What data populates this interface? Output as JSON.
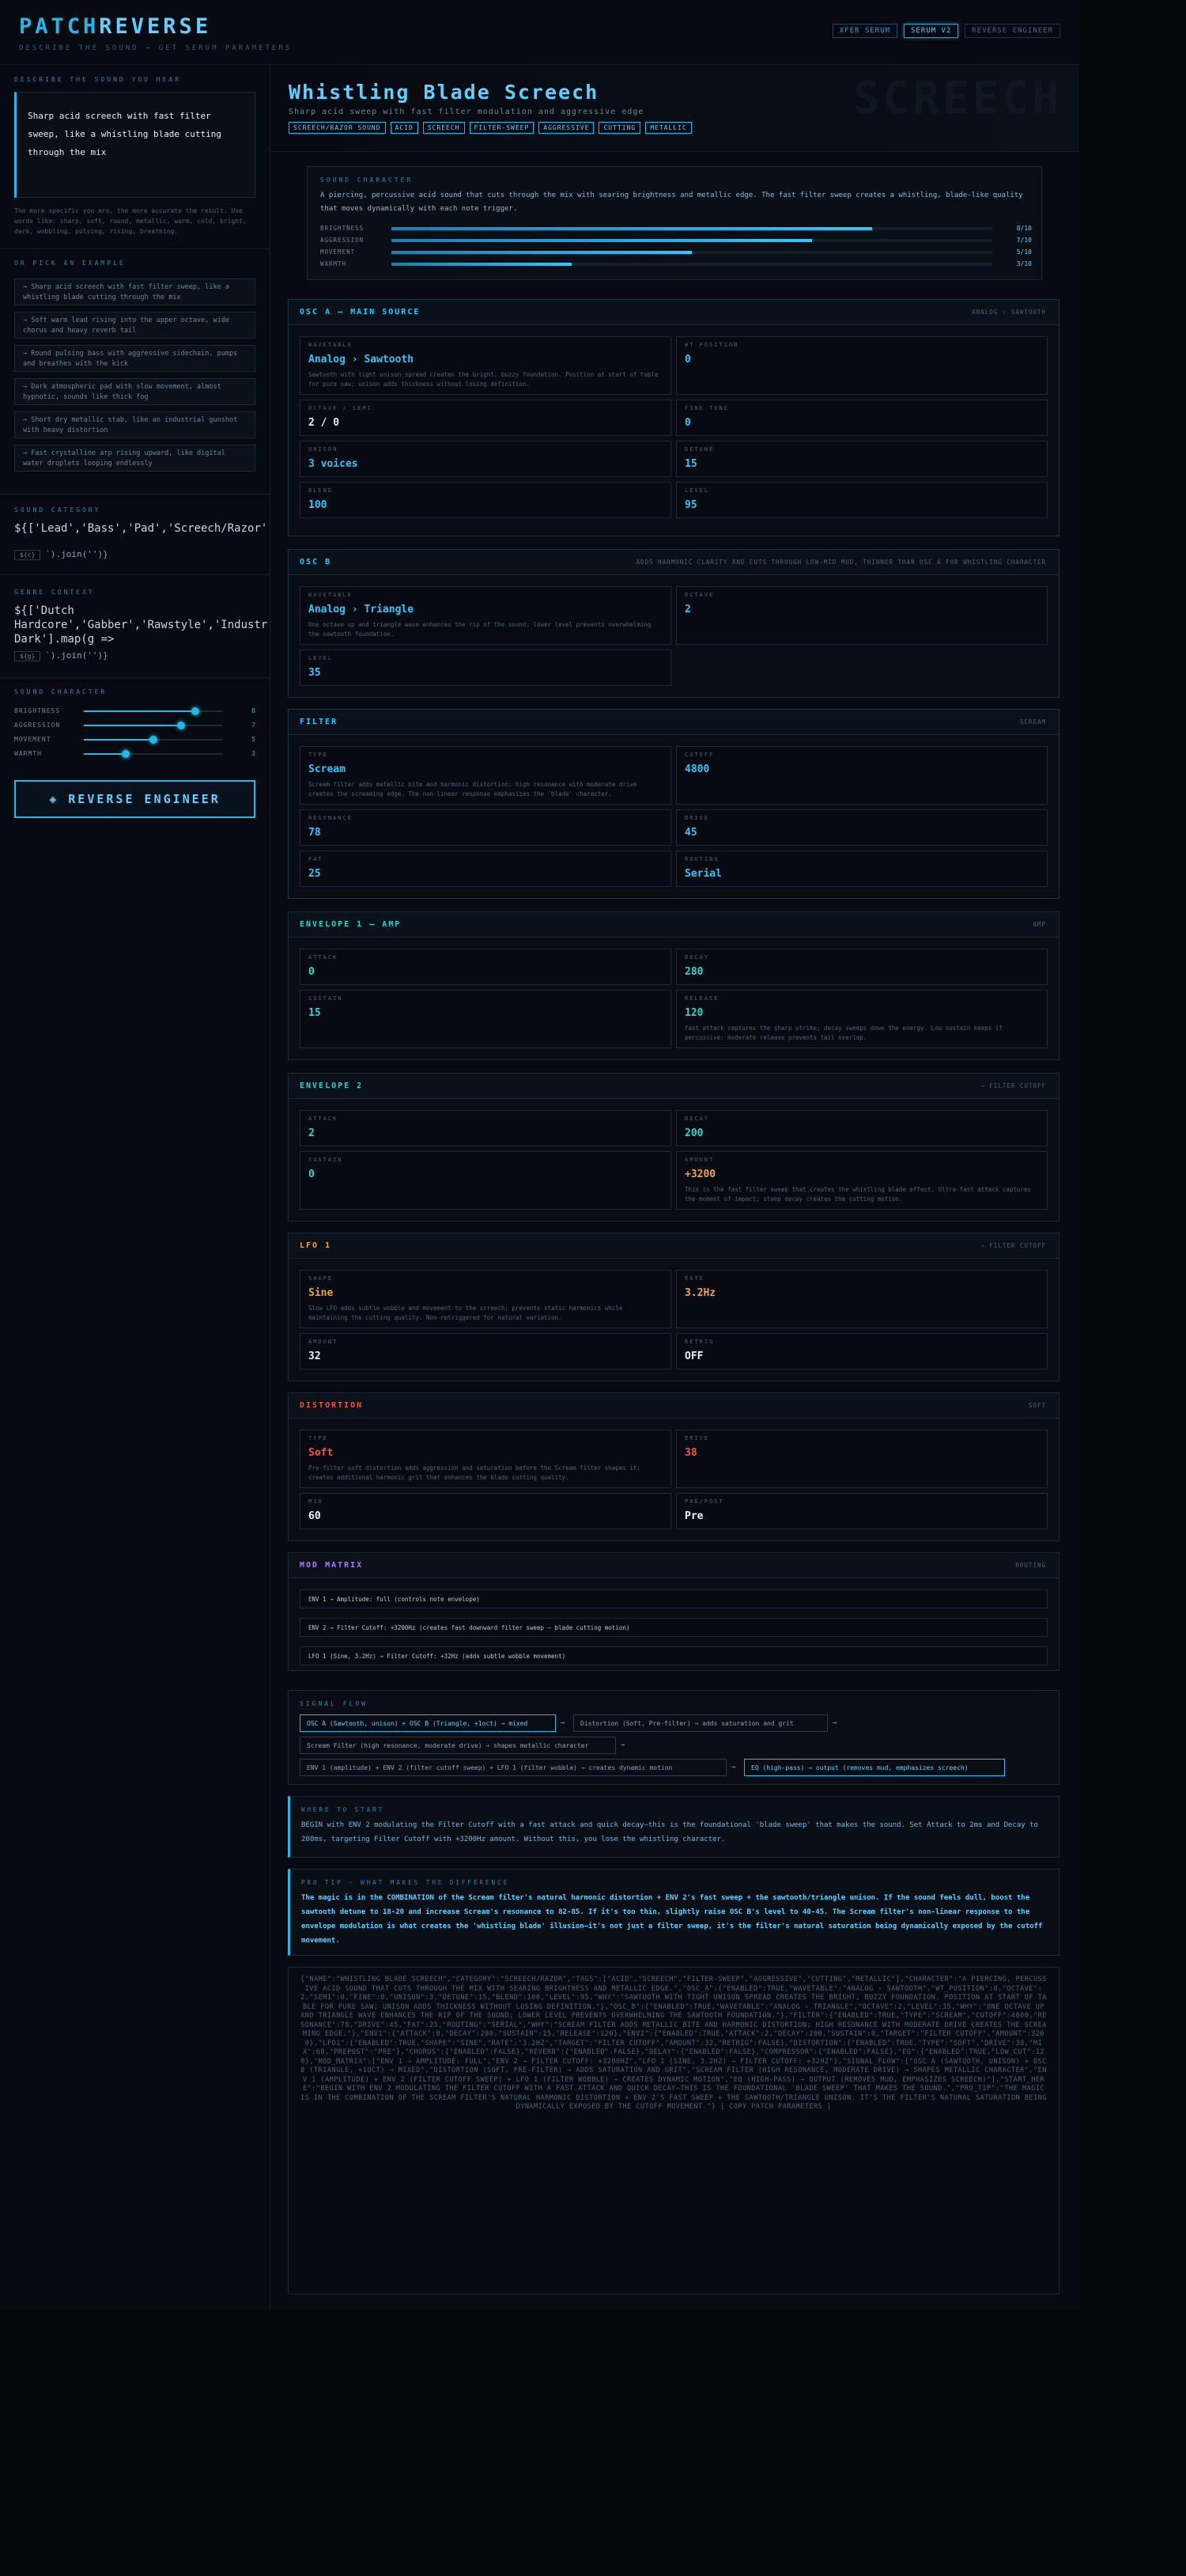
{
  "header": {
    "logo_a": "PATCH",
    "logo_b": "REVERSE",
    "tagline": "DESCRIBE THE SOUND → GET SERUM PARAMETERS",
    "buttons": [
      "XFER SERUM",
      "SERUM V2",
      "REVERSE ENGINEER"
    ]
  },
  "sidebar": {
    "describe_label": "DESCRIBE THE SOUND YOU HEAR",
    "description": "Sharp acid screech with fast filter sweep, like a whistling blade cutting through the mix",
    "description_note": "The more specific you are, the more accurate the result. Use words like: sharp, soft, round, metallic, warm, cold, bright, dark, wobbling, pulsing, rising, breathing.",
    "examples_label": "OR PICK AN EXAMPLE",
    "examples": [
      "→ Sharp acid screech with fast filter sweep, like a whistling blade cutting through the mix",
      "→ Soft warm lead rising into the upper octave, wide chorus and heavy reverb tail",
      "→ Round pulsing bass with aggressive sidechain, pumps and breathes with the kick",
      "→ Dark atmospheric pad with slow movement, almost hypnotic, sounds like thick fog",
      "→ Short dry metallic stab, like an industrial gunshot with heavy distortion",
      "→ Fast crystalline arp rising upward, like digital water droplets looping endlessly"
    ],
    "category_label": "SOUND CATEGORY",
    "category_code": "${['Lead','Bass','Pad','Screech/Razor','Stab','Arp','FX'].map(c =>",
    "category_chip": "${c}",
    "category_tail": "`).join('')}",
    "context_label": "GENRE CONTEXT",
    "context_code_1": "${['Dutch",
    "context_code_2": "Hardcore','Gabber','Rawstyle','Industrial','Early Rave','",
    "context_code_3": "Dark'].map(g =>",
    "context_chip": "${g}",
    "context_tail": "`).join('')}",
    "character_label": "SOUND CHARACTER",
    "sliders": [
      {
        "label": "BRIGHTNESS",
        "value": 8,
        "max": 10
      },
      {
        "label": "AGGRESSION",
        "value": 7,
        "max": 10
      },
      {
        "label": "MOVEMENT",
        "value": 5,
        "max": 10
      },
      {
        "label": "WARMTH",
        "value": 3,
        "max": 10
      }
    ],
    "reverse_button": "◈ REVERSE ENGINEER"
  },
  "hero": {
    "title": "Whistling Blade Screech",
    "subtitle": "Sharp acid sweep with fast filter modulation and aggressive edge",
    "ghost": "SCREECH",
    "tags": [
      "SCREECH/RAZOR SOUND",
      "ACID",
      "SCREECH",
      "FILTER-SWEEP",
      "AGGRESSIVE",
      "CUTTING",
      "METALLIC"
    ]
  },
  "character": {
    "head": "SOUND CHARACTER",
    "text": "A piercing, percussive acid sound that cuts through the mix with searing brightness and metallic edge. The fast filter sweep creates a whistling, blade-like quality that moves dynamically with each note trigger.",
    "bars": [
      {
        "label": "BRIGHTNESS",
        "value": 8,
        "max": 10,
        "text": "8/10"
      },
      {
        "label": "AGGRESSION",
        "value": 7,
        "max": 10,
        "text": "7/10"
      },
      {
        "label": "MOVEMENT",
        "value": 5,
        "max": 10,
        "text": "5/10"
      },
      {
        "label": "WARMTH",
        "value": 3,
        "max": 10,
        "text": "3/10"
      }
    ]
  },
  "osc_a": {
    "title": "OSC A — MAIN SOURCE",
    "note": "ANALOG › SAWTOOTH",
    "params": [
      {
        "label": "WAVETABLE",
        "value": "Analog › Sawtooth",
        "desc": "Sawtooth with tight unison spread creates the bright, buzzy foundation. Position at start of table for pure saw; unison adds thickness without losing definition."
      },
      {
        "label": "WT POSITION",
        "value": "0"
      },
      {
        "label": "OCTAVE / SEMI",
        "value": "2 / 0"
      },
      {
        "label": "FINE TUNE",
        "value": "0"
      },
      {
        "label": "UNISON",
        "value": "3 voices"
      },
      {
        "label": "DETUNE",
        "value": "15"
      },
      {
        "label": "BLEND",
        "value": "100"
      },
      {
        "label": "LEVEL",
        "value": "95"
      }
    ]
  },
  "osc_b": {
    "title": "OSC B",
    "note": "ADDS HARMONIC CLARITY AND CUTS THROUGH LOW-MID MUD, THINNER THAN OSC A FOR WHISTLING CHARACTER",
    "params": [
      {
        "label": "WAVETABLE",
        "value": "Analog › Triangle",
        "desc": "One octave up and triangle wave enhances the rip of the sound; lower level prevents overwhelming the sawtooth foundation."
      },
      {
        "label": "OCTAVE",
        "value": "2"
      },
      {
        "label": "LEVEL",
        "value": "35"
      }
    ]
  },
  "filter": {
    "title": "FILTER",
    "note": "SCREAM",
    "params": [
      {
        "label": "TYPE",
        "value": "Scream",
        "desc": "Scream filter adds metallic bite and harmonic distortion; high resonance with moderate drive creates the screaming edge. The non-linear response emphasizes the 'blade' character."
      },
      {
        "label": "CUTOFF",
        "value": "4800"
      },
      {
        "label": "RESONANCE",
        "value": "78"
      },
      {
        "label": "DRIVE",
        "value": "45"
      },
      {
        "label": "FAT",
        "value": "25"
      },
      {
        "label": "ROUTING",
        "value": "Serial"
      }
    ]
  },
  "env1": {
    "title": "ENVELOPE 1 — AMP",
    "note": "AMP",
    "params": [
      {
        "label": "ATTACK",
        "value": "0"
      },
      {
        "label": "DECAY",
        "value": "280"
      },
      {
        "label": "SUSTAIN",
        "value": "15"
      },
      {
        "label": "RELEASE",
        "value": "120",
        "desc": "Fast attack captures the sharp strike; decay sweeps down the energy. Low sustain keeps it percussive; moderate release prevents tail overlap."
      }
    ]
  },
  "env2": {
    "title": "ENVELOPE 2",
    "note": "→ FILTER CUTOFF",
    "params": [
      {
        "label": "ATTACK",
        "value": "2"
      },
      {
        "label": "DECAY",
        "value": "200"
      },
      {
        "label": "SUSTAIN",
        "value": "0"
      },
      {
        "label": "AMOUNT",
        "value": "+3200",
        "desc": "This is the fast filter sweep that creates the whistling blade effect. Ultra-fast attack captures the moment of impact; steep decay creates the cutting motion."
      }
    ]
  },
  "lfo1": {
    "title": "LFO 1",
    "note": "→ FILTER CUTOFF",
    "params": [
      {
        "label": "SHAPE",
        "value": "Sine",
        "desc": "Slow LFO adds subtle wobble and movement to the screech; prevents static harmonics while maintaining the cutting quality. Non-retriggered for natural variation."
      },
      {
        "label": "RATE",
        "value": "3.2Hz"
      },
      {
        "label": "AMOUNT",
        "value": "32"
      },
      {
        "label": "RETRIG",
        "value": "OFF"
      }
    ]
  },
  "dist": {
    "title": "DISTORTION",
    "note": "SOFT",
    "params": [
      {
        "label": "TYPE",
        "value": "Soft",
        "desc": "Pre-filter soft distortion adds aggression and saturation before the Scream filter shapes it; creates additional harmonic grit that enhances the blade cutting quality."
      },
      {
        "label": "DRIVE",
        "value": "38"
      },
      {
        "label": "MIX",
        "value": "60"
      },
      {
        "label": "PRE/POST",
        "value": "Pre"
      }
    ]
  },
  "mod": {
    "title": "MOD MATRIX",
    "note": "ROUTING",
    "rows": [
      "ENV 1 → Amplitude: full (controls note envelope)",
      "ENV 2 → Filter Cutoff: +3200Hz (creates fast downward filter sweep — blade cutting motion)",
      "LFO 1 (Sine, 3.2Hz) → Filter Cutoff: +32Hz (adds subtle wobble movement)"
    ]
  },
  "flow": {
    "head": "SIGNAL FLOW",
    "nodes": [
      "OSC A (Sawtooth, unison) + OSC B (Triangle, +1oct) → mixed",
      "Distortion (Soft, Pre-filter) → adds saturation and grit",
      "Scream Filter (high resonance, moderate drive) → shapes metallic character",
      "ENV 1 (amplitude) + ENV 2 (filter cutoff sweep) + LFO 1 (filter wobble) → creates dynamic motion",
      "EQ (high-pass) → output (removes mud, emphasizes screech)"
    ],
    "arrow": "→"
  },
  "start": {
    "head": "WHERE TO START",
    "body": "BEGIN with ENV 2 modulating the Filter Cutoff with a fast attack and quick decay—this is the foundational 'blade sweep' that makes the sound. Set Attack to 2ms and Decay to 200ms, targeting Filter Cutoff with +3200Hz amount. Without this, you lose the whistling character."
  },
  "protip": {
    "head": "PRO TIP — WHAT MAKES THE DIFFERENCE",
    "body": "The magic is in the COMBINATION of the Scream filter's natural harmonic distortion + ENV 2's fast sweep + the sawtooth/triangle unison. If the sound feels dull, boost the sawtooth detune to 18-20 and increase Scream's resonance to 82-85. If it's too thin, slightly raise OSC B's level to 40-45. The Scream filter's non-linear response to the envelope modulation is what creates the 'whistling blade' illusion—it's not just a filter sweep, it's the filter's natural saturation being dynamically exposed by the cutoff movement."
  },
  "json_dump": "{\"NAME\":\"WHISTLING BLADE SCREECH\",\"CATEGORY\":\"SCREECH/RAZOR\",\"TAGS\":[\"ACID\",\"SCREECH\",\"FILTER-SWEEP\",\"AGGRESSIVE\",\"CUTTING\",\"METALLIC\"],\"CHARACTER\":\"A PIERCING, PERCUSSIVE ACID SOUND THAT CUTS THROUGH THE MIX WITH SEARING BRIGHTNESS AND METALLIC EDGE.\",\"OSC_A\":{\"ENABLED\":TRUE,\"WAVETABLE\":\"ANALOG › SAWTOOTH\",\"WT_POSITION\":0,\"OCTAVE\":2,\"SEMI\":0,\"FINE\":0,\"UNISON\":3,\"DETUNE\":15,\"BLEND\":100,\"LEVEL\":95,\"WHY\":\"SAWTOOTH WITH TIGHT UNISON SPREAD CREATES THE BRIGHT, BUZZY FOUNDATION. POSITION AT START OF TABLE FOR PURE SAW; UNISON ADDS THICKNESS WITHOUT LOSING DEFINITION.\"},\"OSC_B\":{\"ENABLED\":TRUE,\"WAVETABLE\":\"ANALOG › TRIANGLE\",\"OCTAVE\":2,\"LEVEL\":35,\"WHY\":\"ONE OCTAVE UP AND TRIANGLE WAVE ENHANCES THE RIP OF THE SOUND; LOWER LEVEL PREVENTS OVERWHELMING THE SAWTOOTH FOUNDATION.\"},\"FILTER\":{\"ENABLED\":TRUE,\"TYPE\":\"SCREAM\",\"CUTOFF\":4800,\"RESONANCE\":78,\"DRIVE\":45,\"FAT\":25,\"ROUTING\":\"SERIAL\",\"WHY\":\"SCREAM FILTER ADDS METALLIC BITE AND HARMONIC DISTORTION; HIGH RESONANCE WITH MODERATE DRIVE CREATES THE SCREAMING EDGE.\"},\"ENV1\":{\"ATTACK\":0,\"DECAY\":280,\"SUSTAIN\":15,\"RELEASE\":120},\"ENV2\":{\"ENABLED\":TRUE,\"ATTACK\":2,\"DECAY\":200,\"SUSTAIN\":0,\"TARGET\":\"FILTER CUTOFF\",\"AMOUNT\":3200},\"LFO1\":{\"ENABLED\":TRUE,\"SHAPE\":\"SINE\",\"RATE\":\"3.2HZ\",\"TARGET\":\"FILTER CUTOFF\",\"AMOUNT\":32,\"RETRIG\":FALSE},\"DISTORTION\":{\"ENABLED\":TRUE,\"TYPE\":\"SOFT\",\"DRIVE\":38,\"MIX\":60,\"PREPOST\":\"PRE\"},\"CHORUS\":{\"ENABLED\":FALSE},\"REVERB\":{\"ENABLED\":FALSE},\"DELAY\":{\"ENABLED\":FALSE},\"COMPRESSOR\":{\"ENABLED\":FALSE},\"EQ\":{\"ENABLED\":TRUE,\"LOW_CUT\":120},\"MOD_MATRIX\":[\"ENV 1 → AMPLITUDE: FULL\",\"ENV 2 → FILTER CUTOFF: +3200HZ\",\"LFO 1 (SINE, 3.2HZ) → FILTER CUTOFF: +32HZ\"],\"SIGNAL_FLOW\":[\"OSC A (SAWTOOTH, UNISON) + OSC B (TRIANGLE, +1OCT) → MIXED\",\"DISTORTION (SOFT, PRE-FILTER) → ADDS SATURATION AND GRIT\",\"SCREAM FILTER (HIGH RESONANCE, MODERATE DRIVE) → SHAPES METALLIC CHARACTER\",\"ENV 1 (AMPLITUDE) + ENV 2 (FILTER CUTOFF SWEEP) + LFO 1 (FILTER WOBBLE) → CREATES DYNAMIC MOTION\",\"EQ (HIGH-PASS) → OUTPUT (REMOVES MUD, EMPHASIZES SCREECH)\"],\"START_HERE\":\"BEGIN WITH ENV 2 MODULATING THE FILTER CUTOFF WITH A FAST ATTACK AND QUICK DECAY—THIS IS THE FOUNDATIONAL 'BLADE SWEEP' THAT MAKES THE SOUND.\",\"PRO_TIP\":\"THE MAGIC IS IN THE COMBINATION OF THE SCREAM FILTER'S NATURAL HARMONIC DISTORTION + ENV 2'S FAST SWEEP + THE SAWTOOTH/TRIANGLE UNISON. IT'S THE FILTER'S NATURAL SATURATION BEING DYNAMICALLY EXPOSED BY THE CUTOFF MOVEMENT.\"} [ COPY PATCH PARAMETERS ]"
}
